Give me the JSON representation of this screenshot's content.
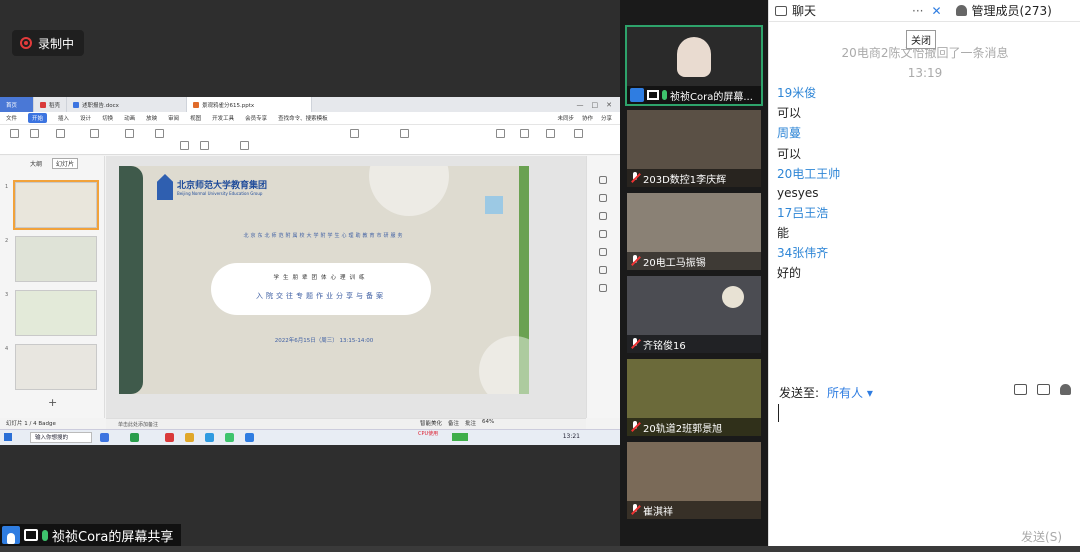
{
  "recording": {
    "label": "录制中"
  },
  "shared_window": {
    "tabs": [
      {
        "label": "首页",
        "color": "#4a78d6"
      },
      {
        "label": "稻壳",
        "color": "#d93a3a"
      },
      {
        "label": "述职报告.docx",
        "color": "#3c74e0"
      },
      {
        "label": "景观鸦雀分615.pptx",
        "color": "#e06b2a"
      }
    ],
    "menu": [
      "文件",
      "开始",
      "插入",
      "设计",
      "切换",
      "动画",
      "放映",
      "审阅",
      "视图",
      "开发工具",
      "会员专享"
    ],
    "menu_search": "查找命令、搜索模板",
    "menu_right": [
      "未同步",
      "协作",
      "分享"
    ],
    "left_pane_tabs": [
      "大纲",
      "幻灯片"
    ],
    "thumb_numbers": [
      "1",
      "2",
      "3",
      "4"
    ],
    "slide": {
      "org_cn": "北京师范大学教育集团",
      "org_en": "Beijing Normal University Education Group",
      "subtitle": "北京东北师范附属校大学附学生心理助教育市研服务",
      "pill_line1": "学生朋辈团体心理训练",
      "pill_line2": "入院交往专题作业分享与备案",
      "date": "2022年6月15日（周三） 13:15-14:00"
    },
    "notes_placeholder": "单击此处添加备注",
    "status_left": "幻灯片 1 / 4    Badge",
    "status_right": [
      "智能美化",
      "备注",
      "批注",
      "64%"
    ],
    "taskbar": {
      "search": "输入你想搜的",
      "cpu": "CPU使用",
      "time": "13:21",
      "ime": "中"
    }
  },
  "share_label": {
    "text": "祯祯Cora的屏幕共享"
  },
  "participants": [
    {
      "name": "祯祯Cora的屏幕...",
      "active": true,
      "bg": "#2a2a2a"
    },
    {
      "name": "203D数控1李庆辉",
      "active": false,
      "bg": "#5a5045"
    },
    {
      "name": "20电工马振锡",
      "active": false,
      "bg": "#8a8175"
    },
    {
      "name": "齐铭俊16",
      "active": false,
      "bg": "#4b4c52"
    },
    {
      "name": "20轨道2班郭景旭",
      "active": false,
      "bg": "#6b6a3a"
    },
    {
      "name": "崔淇祥",
      "active": false,
      "bg": "#7a6a58"
    }
  ],
  "chat": {
    "tab_chat": "聊天",
    "more": "···",
    "close_tooltip": "关闭",
    "tab_members": "管理成员(273)",
    "system_msg": "20电商2陈文怡撤回了一条消息",
    "time": "13:19",
    "messages": [
      {
        "name": "19米俊",
        "text": "可以"
      },
      {
        "name": "周蔓",
        "text": "可以"
      },
      {
        "name": "20电工王帅",
        "text": "yesyes"
      },
      {
        "name": "17吕王浩",
        "text": "能"
      },
      {
        "name": "34张伟齐",
        "text": "好的"
      }
    ],
    "send_to_label": "发送至:",
    "send_to_value": "所有人 ▾",
    "send_button": "发送(S)"
  }
}
